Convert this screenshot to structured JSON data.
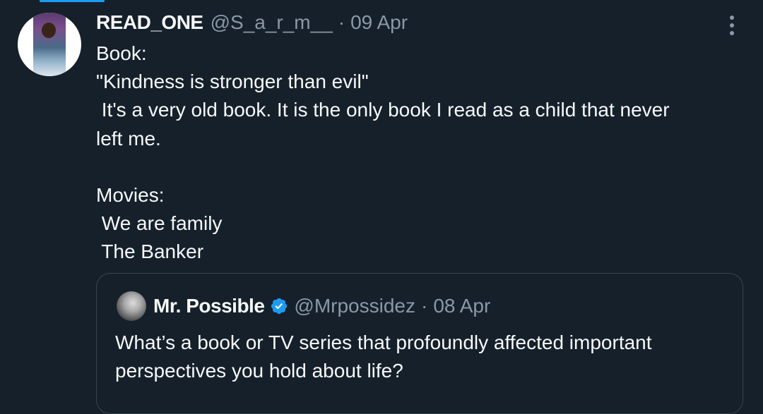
{
  "tweet": {
    "display_name": "READ_ONE",
    "handle": "@S_a_r_m__",
    "separator": "·",
    "date": "09 Apr",
    "lines": [
      "Book:",
      "\"Kindness is stronger than evil\"",
      " It's a very old book. It is the only book I read as a child that never",
      "left me.",
      "",
      "Movies:",
      " We are family",
      " The Banker"
    ]
  },
  "quoted_tweet": {
    "display_name": "Mr. Possible",
    "handle": "@Mrpossidez",
    "separator": "·",
    "date": "08 Apr",
    "lines": [
      "What’s a book or TV series that profoundly affected important",
      "perspectives you hold about life?"
    ]
  },
  "colors": {
    "background": "#15202b",
    "text_primary": "#f7f9f9",
    "text_secondary": "#8b98a5",
    "border": "#38444d",
    "accent": "#1d9bf0"
  },
  "icons": {
    "more": "more-vertical-icon",
    "verified": "verified-badge-icon"
  }
}
